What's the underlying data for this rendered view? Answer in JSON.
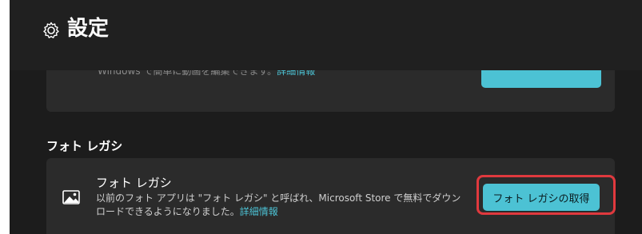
{
  "header": {
    "title": "設定",
    "icon": "gear-icon"
  },
  "previous_card": {
    "description": "Windows で簡単に動画を編集できます。",
    "link": "詳細情報"
  },
  "section": {
    "title": "フォト レガシ"
  },
  "photo_legacy_card": {
    "icon": "image-icon",
    "title": "フォト レガシ",
    "description": "以前のフォト アプリは \"フォト レガシ\" と呼ばれ、Microsoft Store で無料でダウンロードできるようになりました。",
    "link": "詳細情報",
    "button_label": "フォト レガシの取得"
  },
  "colors": {
    "accent": "#4cc2d4",
    "highlight": "#e0393e",
    "background": "#1c1c1c",
    "card": "#2b2b2b"
  }
}
